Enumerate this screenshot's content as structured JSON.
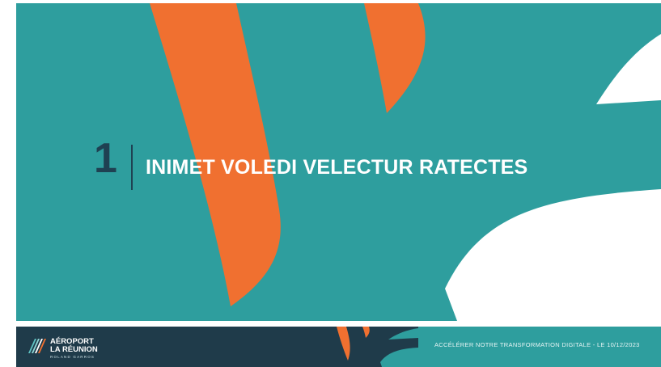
{
  "slide": {
    "section_number": "1",
    "section_title": "INIMET VOLEDI VELECTUR RATECTES"
  },
  "footer": {
    "logo": {
      "line1": "AÉROPORT",
      "line2": "LA RÉUNION",
      "line3": "ROLAND GARROS"
    },
    "caption": "ACCÉLÉRER NOTRE TRANSFORMATION DIGITALE - LE 10/12/2023"
  },
  "colors": {
    "teal": "#2e9e9e",
    "orange": "#f07030",
    "navy": "#1f3b4a",
    "white": "#ffffff"
  }
}
